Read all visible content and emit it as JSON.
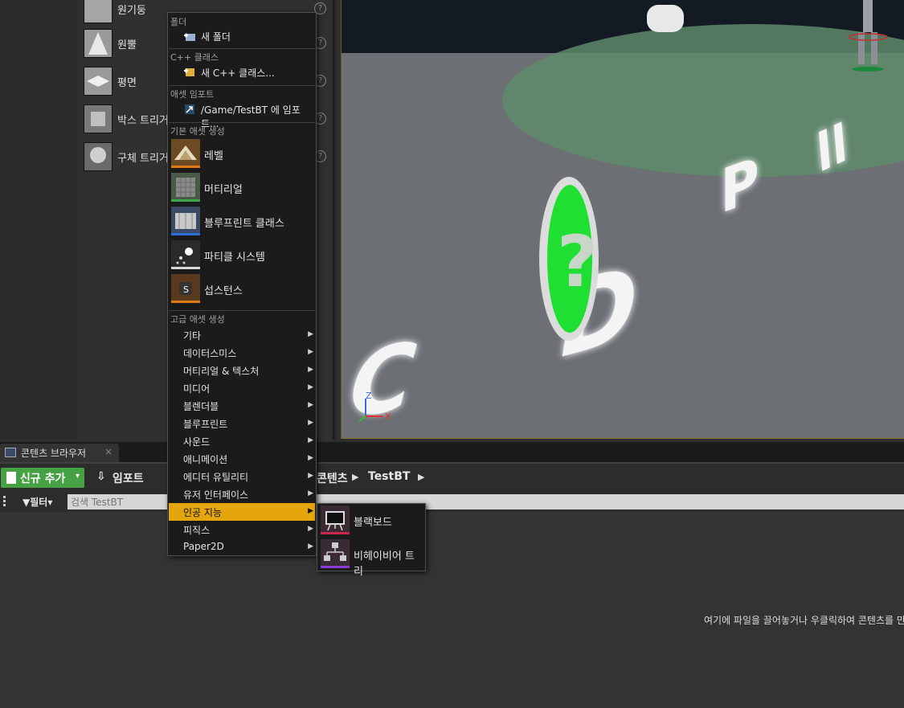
{
  "place_panel": {
    "items": [
      {
        "label": "원기둥",
        "help": "?"
      },
      {
        "label": "원뿔",
        "help": "?"
      },
      {
        "label": "평면",
        "help": "?"
      },
      {
        "label": "박스 트리거",
        "help": "?"
      },
      {
        "label": "구체 트리거",
        "help": "?"
      }
    ]
  },
  "viewport": {
    "axis_z": "Z",
    "axis_x": "X",
    "disc_glyph": "?"
  },
  "content_browser": {
    "tab_label": "콘텐츠 브라우저",
    "tab_close": "×",
    "add_new_label": "신규 추가",
    "add_new_caret": "▾",
    "import_label": "임포트",
    "breadcrumb": [
      "콘텐츠",
      "TestBT"
    ],
    "filter_label": "필터",
    "search_placeholder": "검색 TestBT",
    "empty_hint": "여기에 파일을 끌어놓거나 우클릭하여 콘텐츠를 만"
  },
  "context_menu": {
    "sections": {
      "folder": "폴더",
      "cpp": "C++ 클래스",
      "import": "애셋 임포트",
      "basic": "기본 애셋 생성",
      "advanced": "고급 애셋 생성"
    },
    "new_folder": "새 폴더",
    "new_cpp_class": "새 C++ 클래스...",
    "import_to": "/Game/TestBT 에 임포트...",
    "basic_assets": [
      {
        "label": "레벨",
        "bar_color": "#e07a12",
        "thumb_color": "#6b4a24"
      },
      {
        "label": "머티리얼",
        "bar_color": "#3aa84a",
        "thumb_color": "#4a5a48"
      },
      {
        "label": "블루프린트 클래스",
        "bar_color": "#2c6fd6",
        "thumb_color": "#3a4a66"
      },
      {
        "label": "파티클 시스템",
        "bar_color": "#d8d8d8",
        "thumb_color": "#2a2a2a"
      },
      {
        "label": "섭스턴스",
        "bar_color": "#e07a12",
        "thumb_color": "#5a3a1e"
      }
    ],
    "advanced_categories": [
      {
        "label": "기타"
      },
      {
        "label": "데이터스미스"
      },
      {
        "label": "머티리얼 & 텍스처"
      },
      {
        "label": "미디어"
      },
      {
        "label": "블렌더블"
      },
      {
        "label": "블루프린트"
      },
      {
        "label": "사운드"
      },
      {
        "label": "애니메이션"
      },
      {
        "label": "에디터 유틸리티"
      },
      {
        "label": "유저 인터페이스"
      },
      {
        "label": "인공 지능",
        "active": true
      },
      {
        "label": "피직스"
      },
      {
        "label": "Paper2D"
      }
    ],
    "arrow_glyph": "▶"
  },
  "ai_submenu": {
    "items": [
      {
        "label": "블랙보드",
        "bar_color": "#c8284a"
      },
      {
        "label": "비헤이비어 트리",
        "bar_color": "#8a3ad0"
      }
    ]
  },
  "colors": {
    "accent_orange": "#e5a60d",
    "add_new_green": "#46a044"
  }
}
